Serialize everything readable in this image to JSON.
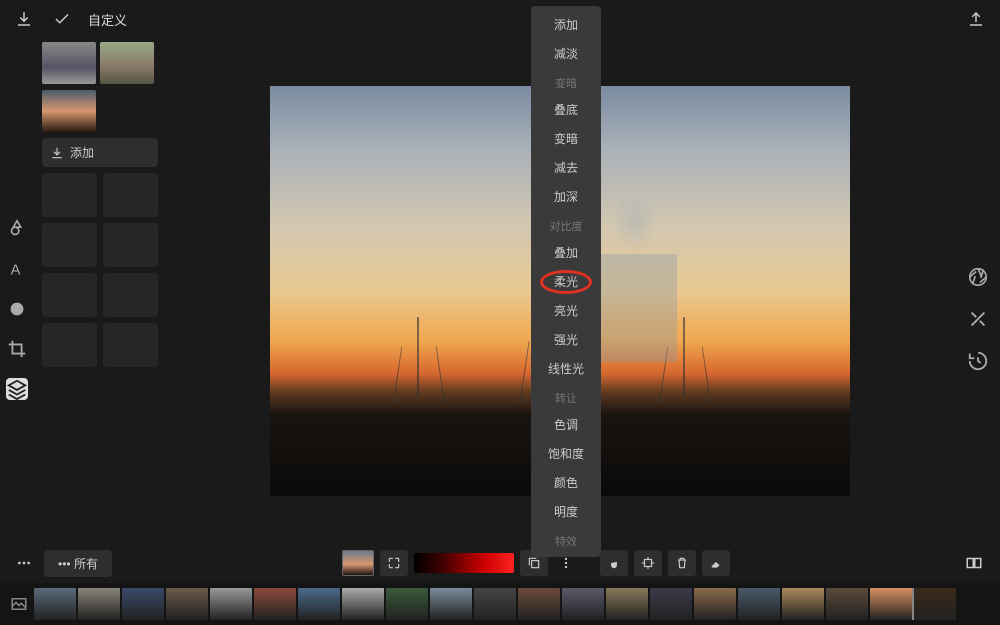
{
  "header": {
    "title": "自定义"
  },
  "sidebar": {
    "add_label": "添加"
  },
  "blend_menu": {
    "items": [
      {
        "label": "添加",
        "type": "item"
      },
      {
        "label": "减淡",
        "type": "item"
      },
      {
        "label": "变暗",
        "type": "header"
      },
      {
        "label": "叠底",
        "type": "item"
      },
      {
        "label": "变暗",
        "type": "item"
      },
      {
        "label": "减去",
        "type": "item"
      },
      {
        "label": "加深",
        "type": "item"
      },
      {
        "label": "对比度",
        "type": "header"
      },
      {
        "label": "叠加",
        "type": "item"
      },
      {
        "label": "柔光",
        "type": "item",
        "highlighted": true
      },
      {
        "label": "亮光",
        "type": "item"
      },
      {
        "label": "强光",
        "type": "item"
      },
      {
        "label": "线性光",
        "type": "item"
      },
      {
        "label": "转让",
        "type": "header"
      },
      {
        "label": "色调",
        "type": "item"
      },
      {
        "label": "饱和度",
        "type": "item"
      },
      {
        "label": "颜色",
        "type": "item"
      },
      {
        "label": "明度",
        "type": "item"
      },
      {
        "label": "特效",
        "type": "header"
      }
    ]
  },
  "bottom": {
    "filter_label": "所有"
  },
  "left_tools": [
    "shape",
    "text",
    "brush",
    "crop",
    "layers"
  ],
  "right_tools": [
    "aperture",
    "fx",
    "history"
  ],
  "filmstrip_colors": [
    "#5a6a7a",
    "#888478",
    "#3a4a6a",
    "#6a5a4a",
    "#999",
    "#8a4a3a",
    "#4a6a8a",
    "#aaa",
    "#3a5a3a",
    "#7a8a9a",
    "#444",
    "#6a4a3a",
    "#5a5a6a",
    "#887a5a",
    "#3a3a4a",
    "#8a6a4a",
    "#4a5a6a",
    "#aa8a5a",
    "#5a4a3a",
    "#d89060",
    "#3a2a1a"
  ]
}
